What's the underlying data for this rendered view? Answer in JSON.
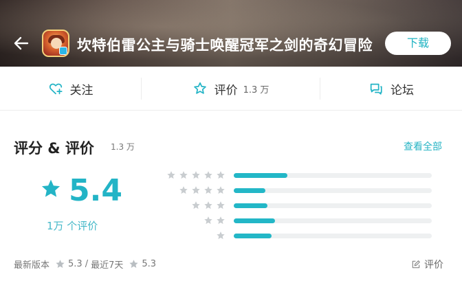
{
  "header": {
    "title": "坎特伯雷公主与骑士唤醒冠军之剑的奇幻冒险",
    "download_label": "下载",
    "accent": "#23b4c6"
  },
  "actions": [
    {
      "label": "关注",
      "icon": "heart-plus-icon",
      "count": ""
    },
    {
      "label": "评价",
      "icon": "star-outline-icon",
      "count": "1.3 万"
    },
    {
      "label": "论坛",
      "icon": "chat-bubble-icon",
      "count": ""
    }
  ],
  "rating": {
    "title": "评分 & 评价",
    "count": "1.3 万",
    "see_all": "查看全部",
    "score": "5.4",
    "score_count": "1万 个评价",
    "distribution": [
      {
        "stars": 5,
        "fraction": 0.27
      },
      {
        "stars": 4,
        "fraction": 0.16
      },
      {
        "stars": 3,
        "fraction": 0.17
      },
      {
        "stars": 2,
        "fraction": 0.21
      },
      {
        "stars": 1,
        "fraction": 0.19
      }
    ]
  },
  "footer": {
    "latest_label": "最新版本",
    "latest_score": "5.3",
    "separator": "/",
    "recent_label": "最近7天",
    "recent_score": "5.3",
    "write_review": "评价"
  }
}
